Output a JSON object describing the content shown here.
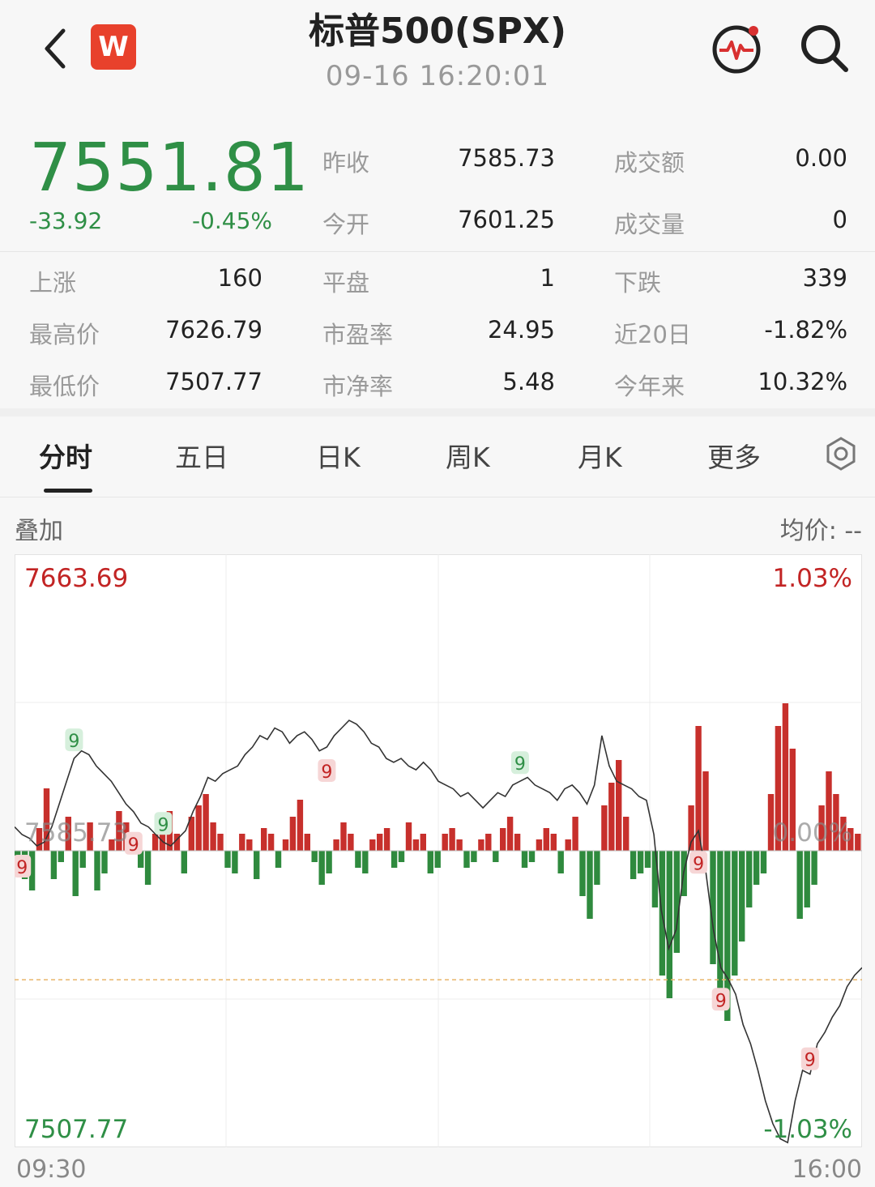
{
  "header": {
    "title": "标普500(SPX)",
    "datetime": "09-16 16:20:01",
    "logo_text": "W"
  },
  "quote": {
    "price": "7551.81",
    "change": "-33.92",
    "change_pct": "-0.45%",
    "color_down": "#2f8f46",
    "color_up": "#c22424"
  },
  "stats": [
    {
      "label": "昨收",
      "value": "7585.73"
    },
    {
      "label": "成交额",
      "value": "0.00"
    },
    {
      "label": "今开",
      "value": "7601.25"
    },
    {
      "label": "成交量",
      "value": "0"
    },
    {
      "label": "上涨",
      "value": "160"
    },
    {
      "label": "平盘",
      "value": "1"
    },
    {
      "label": "下跌",
      "value": "339"
    },
    {
      "label": "最高价",
      "value": "7626.79"
    },
    {
      "label": "市盈率",
      "value": "24.95"
    },
    {
      "label": "近20日",
      "value": "-1.82%"
    },
    {
      "label": "最低价",
      "value": "7507.77"
    },
    {
      "label": "市净率",
      "value": "5.48"
    },
    {
      "label": "今年来",
      "value": "10.32%"
    }
  ],
  "tabs": [
    "分时",
    "五日",
    "日K",
    "周K",
    "月K",
    "更多"
  ],
  "active_tab": "分时",
  "chart_header": {
    "overlay": "叠加",
    "avg_price": "均价: --"
  },
  "chart_data": {
    "type": "line",
    "y_max_label": "7663.69",
    "y_ref_label": "7585.73",
    "y_min_label": "7507.77",
    "pct_max_label": "1.03%",
    "pct_ref_label": "0.00%",
    "pct_min_label": "-1.03%",
    "x_start": "09:30",
    "x_end": "16:00",
    "ylim": [
      7507.77,
      7663.69
    ],
    "reference": 7585.73,
    "marker_label": "9",
    "price": [
      7592,
      7590,
      7589,
      7587,
      7588,
      7592,
      7598,
      7604,
      7610,
      7612,
      7611,
      7608,
      7606,
      7604,
      7601,
      7598,
      7596,
      7593,
      7592,
      7590,
      7588,
      7587,
      7589,
      7591,
      7596,
      7600,
      7605,
      7604,
      7606,
      7607,
      7608,
      7611,
      7613,
      7616,
      7615,
      7618,
      7617,
      7614,
      7616,
      7617,
      7615,
      7612,
      7613,
      7616,
      7618,
      7620,
      7619,
      7617,
      7614,
      7613,
      7610,
      7609,
      7610,
      7608,
      7607,
      7609,
      7607,
      7604,
      7603,
      7602,
      7600,
      7601,
      7599,
      7597,
      7599,
      7601,
      7600,
      7603,
      7604,
      7605,
      7603,
      7602,
      7601,
      7599,
      7602,
      7603,
      7601,
      7598,
      7603,
      7616,
      7608,
      7604,
      7603,
      7602,
      7600,
      7599,
      7590,
      7570,
      7560,
      7565,
      7580,
      7588,
      7591,
      7580,
      7565,
      7555,
      7552,
      7548,
      7540,
      7535,
      7528,
      7520,
      7514,
      7510,
      7509,
      7520,
      7528,
      7527,
      7535,
      7538,
      7542,
      7545,
      7550,
      7553,
      7555
    ],
    "volume": [
      -3,
      -5,
      -7,
      4,
      11,
      -5,
      -2,
      6,
      -8,
      -3,
      5,
      -7,
      -4,
      2,
      7,
      5,
      2,
      -3,
      -6,
      3,
      5,
      7,
      3,
      -4,
      6,
      8,
      10,
      5,
      3,
      -3,
      -4,
      3,
      2,
      -5,
      4,
      3,
      -3,
      2,
      6,
      9,
      3,
      -2,
      -6,
      -4,
      2,
      5,
      3,
      -3,
      -4,
      2,
      3,
      4,
      -3,
      -2,
      5,
      2,
      3,
      -4,
      -3,
      3,
      4,
      2,
      -3,
      -2,
      2,
      3,
      -2,
      4,
      6,
      3,
      -3,
      -2,
      2,
      4,
      3,
      -4,
      2,
      6,
      -8,
      -12,
      -6,
      8,
      12,
      16,
      6,
      -5,
      -4,
      -3,
      -10,
      -22,
      -26,
      -18,
      -8,
      8,
      22,
      14,
      -20,
      -26,
      -30,
      -22,
      -16,
      -10,
      -6,
      -4,
      10,
      22,
      26,
      18,
      -12,
      -10,
      -6,
      8,
      14,
      10,
      6,
      4,
      3
    ]
  }
}
